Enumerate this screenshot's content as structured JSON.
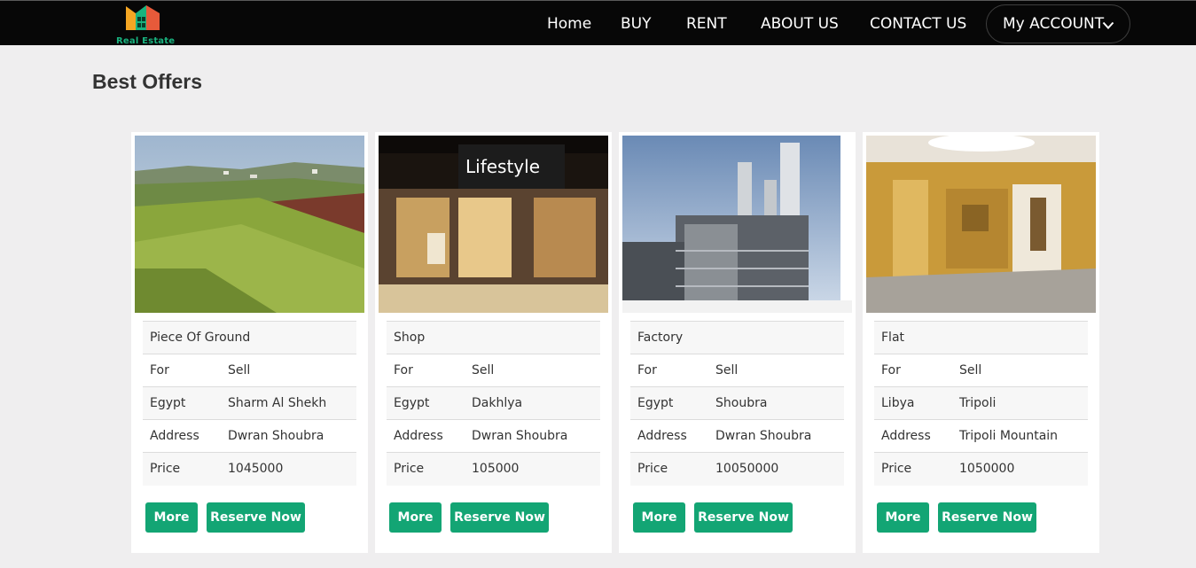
{
  "brand": {
    "name": "Real Estate",
    "colors": {
      "orange": "#f5a623",
      "green": "#19b37f",
      "red": "#e23b3b"
    }
  },
  "nav": {
    "items": [
      "Home",
      "BUY",
      "RENT",
      "ABOUT US",
      "CONTACT US"
    ],
    "account": "My ACCOUNT"
  },
  "page": {
    "title": "Best Offers"
  },
  "offers": [
    {
      "type": "Piece Of Ground",
      "rows": [
        [
          "For",
          "Sell"
        ],
        [
          "Egypt",
          "Sharm Al Shekh"
        ],
        [
          "Address",
          "Dwran Shoubra"
        ],
        [
          "Price",
          "1045000"
        ]
      ],
      "more": "More",
      "reserve": "Reserve Now"
    },
    {
      "type": "Shop",
      "image_text": "Lifestyle",
      "rows": [
        [
          "For",
          "Sell"
        ],
        [
          "Egypt",
          "Dakhlya"
        ],
        [
          "Address",
          "Dwran Shoubra"
        ],
        [
          "Price",
          "105000"
        ]
      ],
      "more": "More",
      "reserve": "Reserve Now"
    },
    {
      "type": "Factory",
      "rows": [
        [
          "For",
          "Sell"
        ],
        [
          "Egypt",
          "Shoubra"
        ],
        [
          "Address",
          "Dwran Shoubra"
        ],
        [
          "Price",
          "10050000"
        ]
      ],
      "more": "More",
      "reserve": "Reserve Now"
    },
    {
      "type": "Flat",
      "rows": [
        [
          "For",
          "Sell"
        ],
        [
          "Libya",
          "Tripoli"
        ],
        [
          "Address",
          "Tripoli Mountain"
        ],
        [
          "Price",
          "1050000"
        ]
      ],
      "more": "More",
      "reserve": "Reserve Now"
    }
  ],
  "accent": "#13a574"
}
